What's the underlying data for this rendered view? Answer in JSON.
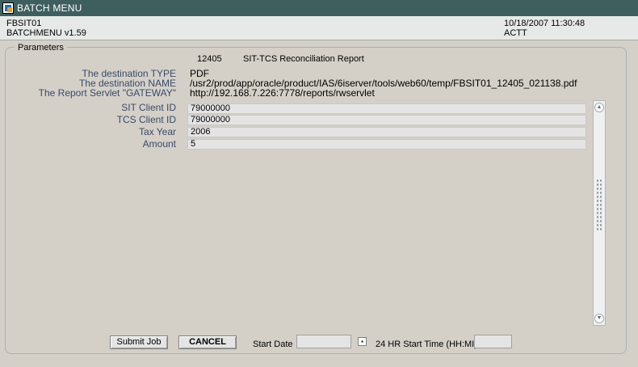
{
  "window": {
    "title": "BATCH MENU"
  },
  "header": {
    "db_name": "FBSIT01",
    "version": "BATCHMENU v1.59",
    "datetime": "10/18/2007 11:30:48",
    "user": "ACTT"
  },
  "parameters": {
    "legend": "Parameters",
    "report_id": "12405",
    "report_name": "SIT-TCS Reconciliation Report",
    "destination_type_label": "The destination TYPE",
    "destination_type_value": "PDF",
    "destination_name_label": "The destination NAME",
    "destination_name_value": "/usr2/prod/app/oracle/product/IAS/6iserver/tools/web60/temp/FBSIT01_12405_021138.pdf",
    "gateway_label": "The Report Servlet \"GATEWAY\"",
    "gateway_value": "http://192.168.7.226:7778/reports/rwservlet",
    "fields": [
      {
        "label": "SIT Client ID",
        "value": "79000000"
      },
      {
        "label": "TCS Client ID",
        "value": "79000000"
      },
      {
        "label": "Tax Year",
        "value": "2006"
      },
      {
        "label": "Amount",
        "value": "5"
      }
    ]
  },
  "footer": {
    "submit_label": "Submit Job",
    "cancel_label": "CANCEL",
    "start_date_label": "Start Date",
    "start_date_value": "",
    "calendar_btn": "▪",
    "start_time_label": "24 HR Start Time (HH:MI)",
    "start_time_value": ""
  }
}
